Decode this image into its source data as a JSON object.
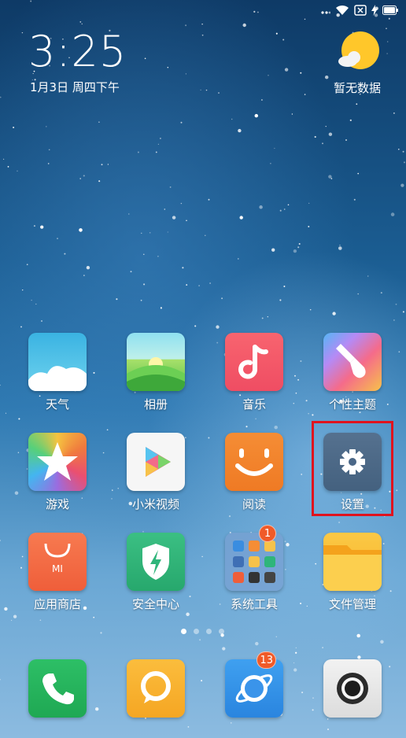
{
  "status_bar": {
    "icons": [
      "signal-dots-icon",
      "wifi-icon",
      "sim-none-icon",
      "charging-icon",
      "battery-icon"
    ]
  },
  "lockclock": {
    "time": "3:25",
    "date": "1月3日 周四下午"
  },
  "weather": {
    "icon": "sun-cloud-icon",
    "text": "暂无数据"
  },
  "apps": {
    "row1": [
      {
        "label": "天气",
        "icon": "weather-app-icon",
        "color": "#4fc3e6"
      },
      {
        "label": "相册",
        "icon": "gallery-app-icon",
        "color": "#7ad46a"
      },
      {
        "label": "音乐",
        "icon": "music-app-icon",
        "color": "#f25b6a"
      },
      {
        "label": "个性主题",
        "icon": "themes-app-icon",
        "color": "#f7a84a"
      }
    ],
    "row2": [
      {
        "label": "游戏",
        "icon": "games-app-icon",
        "color": "#f6b43c"
      },
      {
        "label": "小米视频",
        "icon": "video-app-icon",
        "color": "#f5f5f5"
      },
      {
        "label": "阅读",
        "icon": "reading-app-icon",
        "color": "#f2832f"
      },
      {
        "label": "设置",
        "icon": "settings-app-icon",
        "color": "#4e6a8c"
      }
    ],
    "row3": [
      {
        "label": "应用商店",
        "icon": "app-store-icon",
        "color": "#f26b42"
      },
      {
        "label": "安全中心",
        "icon": "security-app-icon",
        "color": "#2fb57a"
      },
      {
        "label": "系统工具",
        "icon": "folder-icon",
        "color": "#5b84b8",
        "badge": "1"
      },
      {
        "label": "文件管理",
        "icon": "file-manager-icon",
        "color": "#f8be38"
      }
    ]
  },
  "dock": [
    {
      "icon": "phone-app-icon",
      "color": "#25b45e"
    },
    {
      "icon": "messages-app-icon",
      "color": "#f8b233"
    },
    {
      "icon": "browser-app-icon",
      "color": "#2f8fe6",
      "badge": "13"
    },
    {
      "icon": "camera-app-icon",
      "color": "#e9e9e9"
    }
  ],
  "page_indicator": {
    "pages": 4,
    "current": 1
  }
}
